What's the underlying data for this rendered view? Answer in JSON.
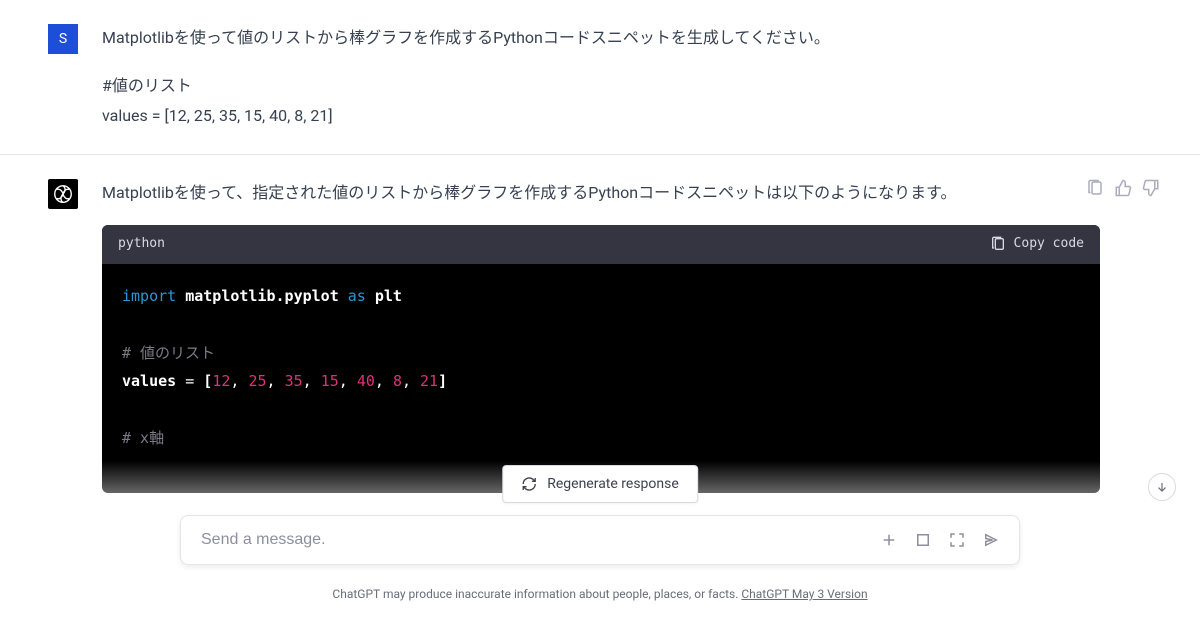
{
  "user": {
    "avatar_letter": "S",
    "line1": "Matplotlibを使って値のリストから棒グラフを作成するPythonコードスニペットを生成してください。",
    "line2": "#値のリスト",
    "line3": "values = [12, 25, 35, 15, 40, 8, 21]"
  },
  "assistant": {
    "intro": "Matplotlibを使って、指定された値のリストから棒グラフを作成するPythonコードスニペットは以下のようになります。",
    "code_lang": "python",
    "copy_label": "Copy code",
    "code": {
      "kw_import": "import",
      "mod": "matplotlib.pyplot",
      "kw_as": "as",
      "alias": "plt",
      "comment1": "# 値のリスト",
      "var": "values",
      "eq": " = ",
      "lbr": "[",
      "n0": "12",
      "n1": "25",
      "n2": "35",
      "n3": "15",
      "n4": "40",
      "n5": "8",
      "n6": "21",
      "comma": ", ",
      "rbr": "]",
      "comment2": "# x軸"
    }
  },
  "regen_label": "Regenerate response",
  "input_placeholder": "Send a message.",
  "disclaimer_text": "ChatGPT may produce inaccurate information about people, places, or facts. ",
  "disclaimer_link": "ChatGPT May 3 Version"
}
